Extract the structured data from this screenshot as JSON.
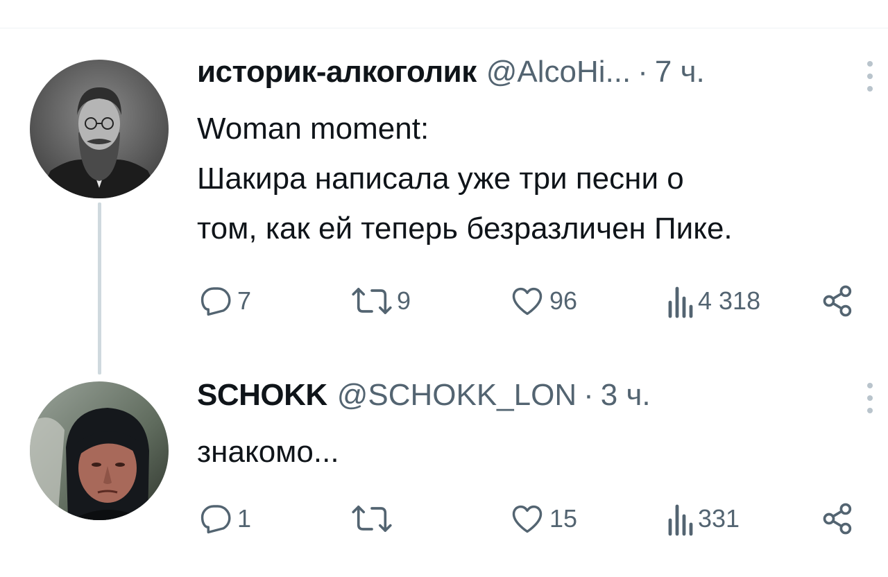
{
  "tweets": [
    {
      "display_name": "историк-алкоголик",
      "handle": "@AlcoHi...",
      "separator": "·",
      "time": "7 ч.",
      "text_lines": [
        "Woman moment:",
        "Шакира написала уже три песни о",
        "том, как ей теперь безразличен Пике."
      ],
      "reply_count": "7",
      "retweet_count": "9",
      "like_count": "96",
      "view_count": "4 318",
      "avatar_icon": "bearded-man-portrait",
      "icons": {
        "reply": "reply-icon",
        "retweet": "retweet-icon",
        "like": "heart-icon",
        "views": "views-icon",
        "share": "share-icon"
      }
    },
    {
      "display_name": "SCHOKK",
      "handle": "@SCHOKK_LON",
      "separator": "·",
      "time": "3 ч.",
      "text_lines": [
        "знакомо..."
      ],
      "reply_count": "1",
      "retweet_count": "",
      "like_count": "15",
      "view_count": "331",
      "avatar_icon": "hooded-man-portrait",
      "icons": {
        "reply": "reply-icon",
        "retweet": "retweet-icon",
        "like": "heart-icon",
        "views": "views-icon",
        "share": "share-icon"
      }
    }
  ],
  "colors": {
    "text_primary": "#0f1419",
    "text_secondary": "#536471",
    "thread_line": "#cfd9de",
    "background": "#ffffff"
  }
}
